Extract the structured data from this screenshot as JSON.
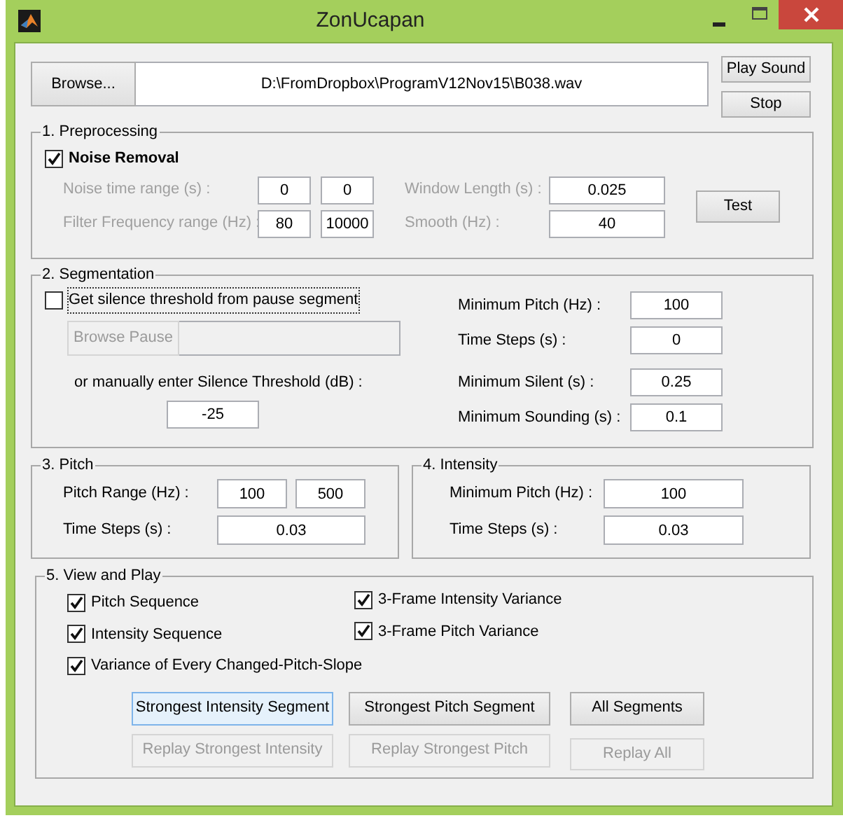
{
  "window": {
    "title": "ZonUcapan"
  },
  "file": {
    "browse_label": "Browse...",
    "path": "D:\\FromDropbox\\ProgramV12Nov15\\B038.wav"
  },
  "playback_buttons": [
    {
      "label": "Play Sound"
    },
    {
      "label": "Stop"
    }
  ],
  "preprocessing": {
    "title": "1. Preprocessing",
    "noise_removal": {
      "label": "Noise Removal",
      "checked": true
    },
    "left_rows": [
      {
        "label": "Noise time range (s) :",
        "disabled": true,
        "values": [
          "0",
          "0"
        ]
      },
      {
        "label": "Filter Frequency range (Hz) :",
        "disabled": true,
        "values": [
          "80",
          "10000"
        ]
      }
    ],
    "right_rows": [
      {
        "label": "Window Length (s) :",
        "disabled": true,
        "value": "0.025"
      },
      {
        "label": "Smooth (Hz) :",
        "disabled": true,
        "value": "40"
      }
    ],
    "test_button": "Test"
  },
  "segmentation": {
    "title": "2. Segmentation",
    "pause_checkbox": {
      "label": "Get silence threshold from pause segment",
      "checked": false,
      "focused": true
    },
    "browse_pause": {
      "label": "Browse Pause",
      "disabled": true
    },
    "manual_label": "or manually enter Silence Threshold (dB) :",
    "threshold": "-25",
    "right_rows": [
      {
        "label": "Minimum Pitch (Hz) :",
        "value": "100"
      },
      {
        "label": "Time Steps (s) :",
        "value": "0"
      },
      {
        "label": "Minimum Silent (s) :",
        "value": "0.25"
      },
      {
        "label": "Minimum Sounding (s) :",
        "value": "0.1"
      }
    ]
  },
  "pitch": {
    "title": "3. Pitch",
    "rows": [
      {
        "label": "Pitch Range (Hz) :",
        "values": [
          "100",
          "500"
        ]
      },
      {
        "label": "Time Steps (s) :",
        "values": [
          "0.03"
        ]
      }
    ]
  },
  "intensity": {
    "title": "4. Intensity",
    "rows": [
      {
        "label": "Minimum Pitch (Hz) :",
        "values": [
          "100"
        ]
      },
      {
        "label": "Time Steps (s) :",
        "values": [
          "0.03"
        ]
      }
    ]
  },
  "view_and_play": {
    "title": "5. View and Play",
    "checkbox_columns": [
      [
        {
          "label": "Pitch Sequence",
          "checked": true
        },
        {
          "label": "Intensity Sequence",
          "checked": true
        },
        {
          "label": "Variance of Every Changed-Pitch-Slope",
          "checked": true
        }
      ],
      [
        {
          "label": "3-Frame Intensity Variance",
          "checked": true
        },
        {
          "label": "3-Frame Pitch Variance",
          "checked": true
        }
      ]
    ],
    "button_rows": [
      [
        {
          "label": "Strongest Intensity Segment",
          "disabled": false,
          "focused": true
        },
        {
          "label": "Strongest Pitch Segment",
          "disabled": false,
          "focused": false
        },
        {
          "label": "All Segments",
          "disabled": false,
          "focused": false
        }
      ],
      [
        {
          "label": "Replay Strongest Intensity",
          "disabled": true,
          "focused": false
        },
        {
          "label": "Replay Strongest Pitch",
          "disabled": true,
          "focused": false
        },
        {
          "label": "Replay All",
          "disabled": true,
          "focused": false
        }
      ]
    ]
  }
}
